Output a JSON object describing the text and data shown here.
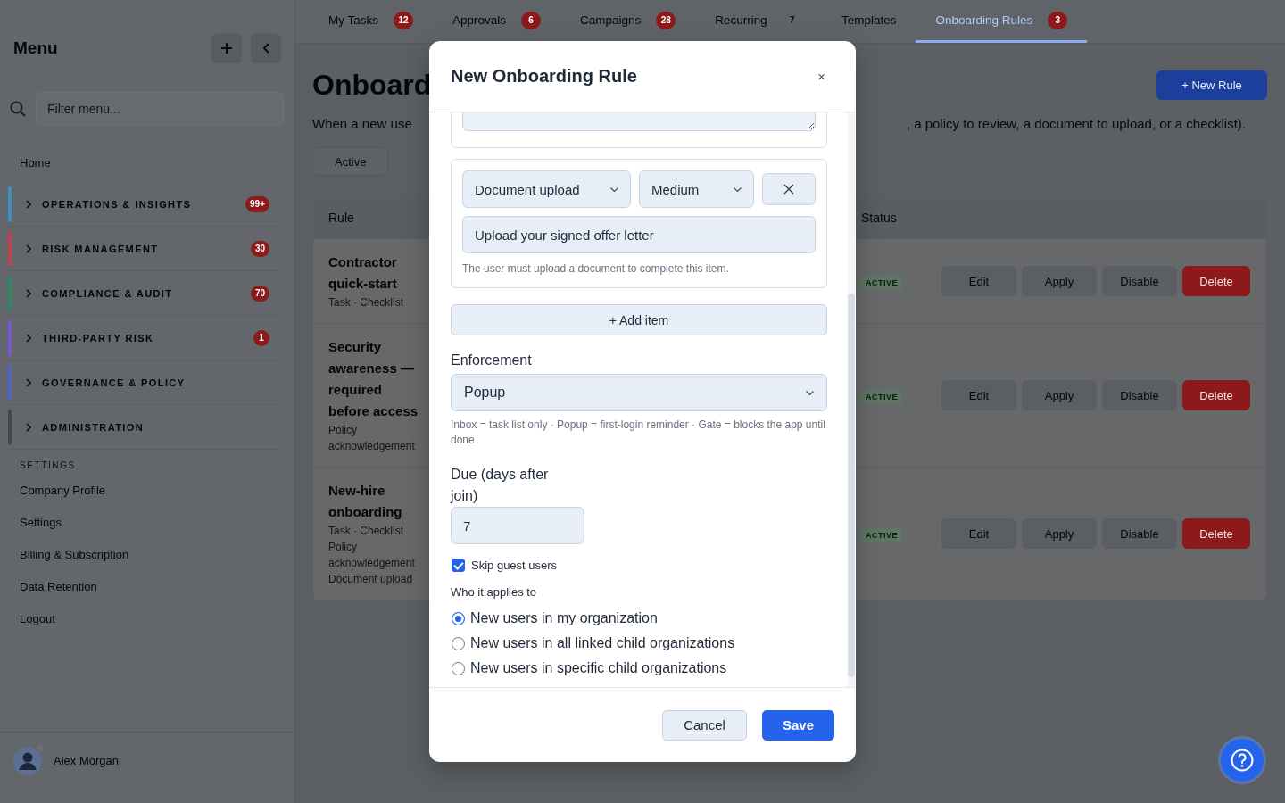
{
  "sidebar": {
    "title": "Menu",
    "search": {
      "placeholder": "Filter menu..."
    },
    "home": "Home",
    "groups": [
      {
        "label": "OPERATIONS & INSIGHTS",
        "badge": "99+",
        "color": "#3b8fc4",
        "expanded": false
      },
      {
        "label": "RISK MANAGEMENT",
        "badge": "30",
        "color": "#c2404f",
        "expanded": false
      },
      {
        "label": "COMPLIANCE & AUDIT",
        "badge": "70",
        "color": "#2a8a62",
        "expanded": false
      },
      {
        "label": "THIRD-PARTY RISK",
        "badge": "1",
        "color": "#7a55d6",
        "expanded": false
      },
      {
        "label": "GOVERNANCE & POLICY",
        "color": "#4d66c4",
        "expanded": false
      },
      {
        "label": "ADMINISTRATION",
        "color": "#45484e",
        "expanded": false
      }
    ],
    "section_label": "SETTINGS",
    "links": [
      "Company Profile",
      "Settings",
      "Billing & Subscription",
      "Data Retention",
      "Logout"
    ],
    "user": {
      "name": "Alex Morgan"
    }
  },
  "tabs": [
    {
      "label": "My Tasks",
      "badge": {
        "text": "12",
        "kind": "alert"
      },
      "selected": false
    },
    {
      "label": "Approvals",
      "badge": {
        "text": "6",
        "kind": "alert"
      },
      "selected": false
    },
    {
      "label": "Campaigns",
      "badge": {
        "text": "28",
        "kind": "alert"
      },
      "selected": false
    },
    {
      "label": "Recurring",
      "badge": {
        "text": "7",
        "kind": "muted"
      },
      "selected": false
    },
    {
      "label": "Templates",
      "selected": false
    },
    {
      "label": "Onboarding Rules",
      "badge": {
        "text": "3",
        "kind": "alert"
      },
      "selected": true
    }
  ],
  "page": {
    "title": "Onboard",
    "description": [
      "When a new use",
      ", a policy to review, a document to upload, or a checklist)."
    ],
    "new_button": "+ New Rule",
    "filters": [
      {
        "label": "Active",
        "selected": false
      }
    ]
  },
  "table": {
    "columns": [
      "Rule",
      "Status"
    ],
    "rows": [
      {
        "name": "Contractor quick-start",
        "meta": [
          "Task · Checklist"
        ],
        "status": "ACTIVE",
        "actions": [
          {
            "label": "Edit",
            "kind": "default"
          },
          {
            "label": "Apply",
            "kind": "default"
          },
          {
            "label": "Disable",
            "kind": "default"
          },
          {
            "label": "Delete",
            "kind": "danger"
          }
        ]
      },
      {
        "name": "Security awareness — required before access",
        "meta": [
          "Policy acknowledgement"
        ],
        "status": "ACTIVE",
        "actions": [
          {
            "label": "Edit",
            "kind": "default"
          },
          {
            "label": "Apply",
            "kind": "default"
          },
          {
            "label": "Disable",
            "kind": "default"
          },
          {
            "label": "Delete",
            "kind": "danger"
          }
        ]
      },
      {
        "name": "New-hire onboarding",
        "meta": [
          "Task · Checklist",
          "Policy acknowledgement",
          "Document upload"
        ],
        "status": "ACTIVE",
        "actions": [
          {
            "label": "Edit",
            "kind": "default"
          },
          {
            "label": "Apply",
            "kind": "default"
          },
          {
            "label": "Disable",
            "kind": "default"
          },
          {
            "label": "Delete",
            "kind": "danger"
          }
        ]
      }
    ]
  },
  "modal": {
    "title": "New Onboarding Rule",
    "close": "×",
    "items": [
      {
        "kind": "text"
      },
      {
        "kind": "document",
        "type": "Document upload",
        "priority": "Medium",
        "text": "Upload your signed offer letter",
        "hint": "The user must upload a document to complete this item."
      }
    ],
    "add_button": "+ Add item",
    "enforcement": {
      "label": "Enforcement",
      "value": "Popup",
      "hint": "Inbox = task list only · Popup = first-login reminder · Gate = blocks the app until done"
    },
    "due": {
      "label": "Due (days after join)",
      "value": "7"
    },
    "skip_guests": {
      "label": "Skip guest users",
      "checked": true
    },
    "audience": {
      "label": "Who it applies to",
      "options": [
        {
          "label": "New users in my organization",
          "selected": true
        },
        {
          "label": "New users in all linked child organizations",
          "selected": false
        },
        {
          "label": "New users in specific child organizations",
          "selected": false
        }
      ]
    },
    "buttons": [
      {
        "label": "Cancel",
        "kind": "secondary"
      },
      {
        "label": "Save",
        "kind": "primary"
      }
    ]
  }
}
